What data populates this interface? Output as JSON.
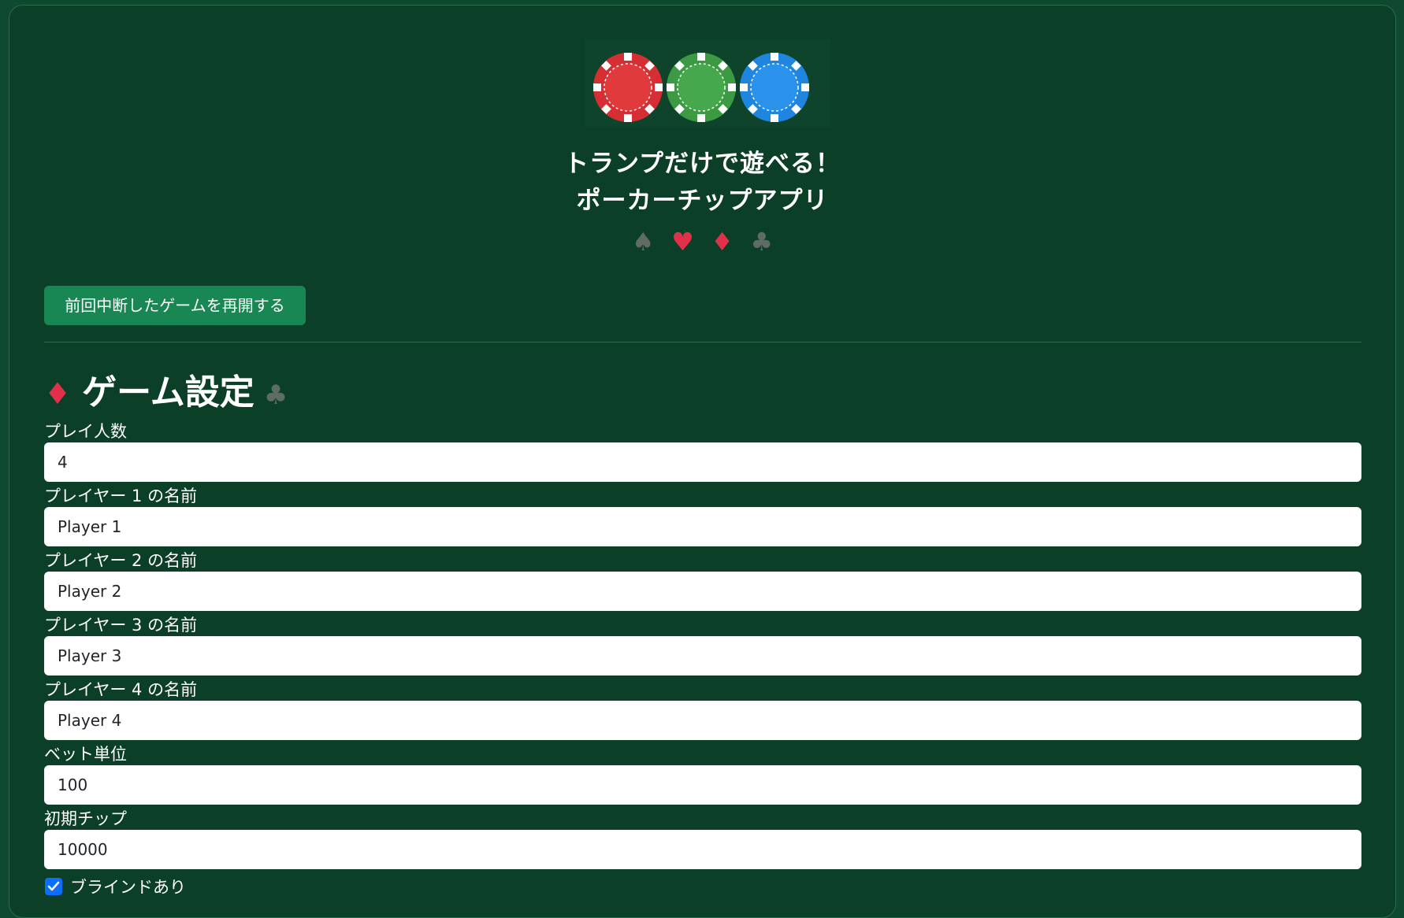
{
  "header": {
    "title_line1": "トランプだけで遊べる！",
    "title_line2": "ポーカーチップアプリ",
    "chips": [
      "red-chip",
      "green-chip",
      "blue-chip"
    ],
    "chip_colors": [
      "#d62f33",
      "#3c9b42",
      "#1e86e0"
    ],
    "suits": [
      "♠",
      "♥",
      "♦",
      "♣"
    ]
  },
  "resume_button": "前回中断したゲームを再開する",
  "settings": {
    "title": "ゲーム設定",
    "suit_left": "♦",
    "suit_right": "♣",
    "fields": [
      {
        "label": "プレイ人数",
        "value": "4"
      },
      {
        "label": "プレイヤー 1 の名前",
        "value": "Player 1"
      },
      {
        "label": "プレイヤー 2 の名前",
        "value": "Player 2"
      },
      {
        "label": "プレイヤー 3 の名前",
        "value": "Player 3"
      },
      {
        "label": "プレイヤー 4 の名前",
        "value": "Player 4"
      },
      {
        "label": "ベット単位",
        "value": "100"
      },
      {
        "label": "初期チップ",
        "value": "10000"
      }
    ],
    "blind_checkbox": {
      "label": "ブラインドあり",
      "checked": true
    }
  },
  "colors": {
    "background": "#0c3f28",
    "button": "#198754",
    "checkbox": "#0d6efd",
    "suit_red": "#e0304a",
    "suit_dark": "#5f6b65"
  }
}
